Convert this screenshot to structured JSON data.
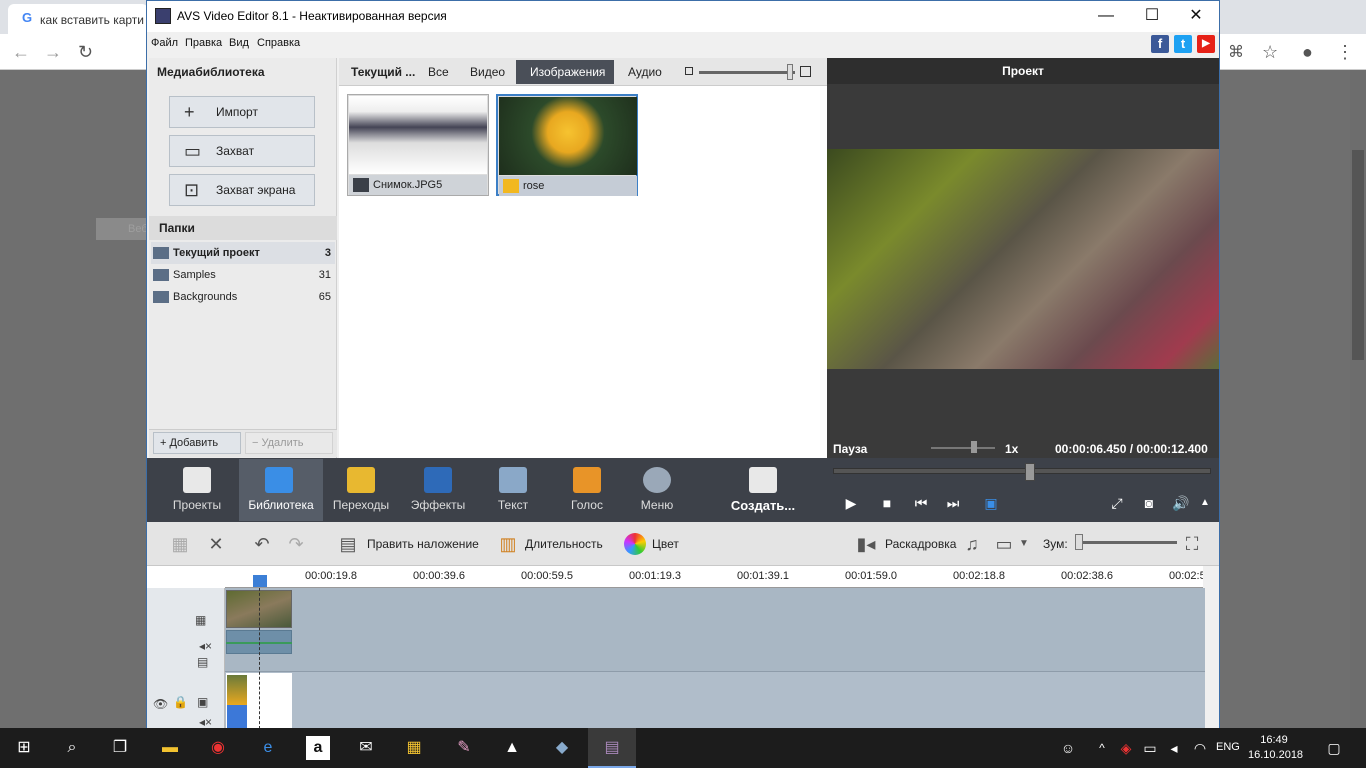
{
  "browser": {
    "tab_title": "как вставить карти",
    "tab_icon": "G",
    "ghost_text": "Веб"
  },
  "window": {
    "title": "AVS Video Editor 8.1 - Неактивированная версия",
    "minimize": "—",
    "maximize": "☐",
    "close": "✕"
  },
  "menu": [
    "Файл",
    "Правка",
    "Вид",
    "Справка"
  ],
  "social": [
    "f",
    "t",
    "▶"
  ],
  "library": {
    "header": "Медиабиблиотека",
    "buttons": [
      "Импорт",
      "Захват",
      "Захват экрана"
    ],
    "folders_header": "Папки",
    "folders": [
      {
        "name": "Текущий проект",
        "count": "3"
      },
      {
        "name": "Samples",
        "count": "31"
      },
      {
        "name": "Backgrounds",
        "count": "65"
      }
    ],
    "add": "Добавить",
    "remove": "Удалить"
  },
  "content": {
    "tab_current": "Текущий ...",
    "tabs": [
      "Все",
      "Видео",
      "Изображения",
      "Аудио"
    ],
    "items": [
      {
        "name": "Снимок.JPG5"
      },
      {
        "name": "rose"
      }
    ]
  },
  "preview": {
    "header": "Проект",
    "status": "Пауза",
    "speed": "1x",
    "time": "00:00:06.450  /  00:00:12.400"
  },
  "toolbar": [
    "Проекты",
    "Библиотека",
    "Переходы",
    "Эффекты",
    "Текст",
    "Голос",
    "Меню",
    "Создать..."
  ],
  "edit": {
    "overlay": "Править наложение",
    "duration": "Длительность",
    "color": "Цвет",
    "storyboard": "Раскадровка",
    "zoom": "Зум:"
  },
  "ruler": [
    "00:00:19.8",
    "00:00:39.6",
    "00:00:59.5",
    "00:01:19.3",
    "00:01:39.1",
    "00:01:59.0",
    "00:02:18.8",
    "00:02:38.6",
    "00:02:5"
  ],
  "taskbar": {
    "lang": "ENG",
    "time": "16:49",
    "date": "16.10.2018"
  },
  "colors": {
    "accent": "#3c7fc6",
    "toolbar_bg": "#3d4149",
    "selected_tab": "#4a4f58"
  }
}
